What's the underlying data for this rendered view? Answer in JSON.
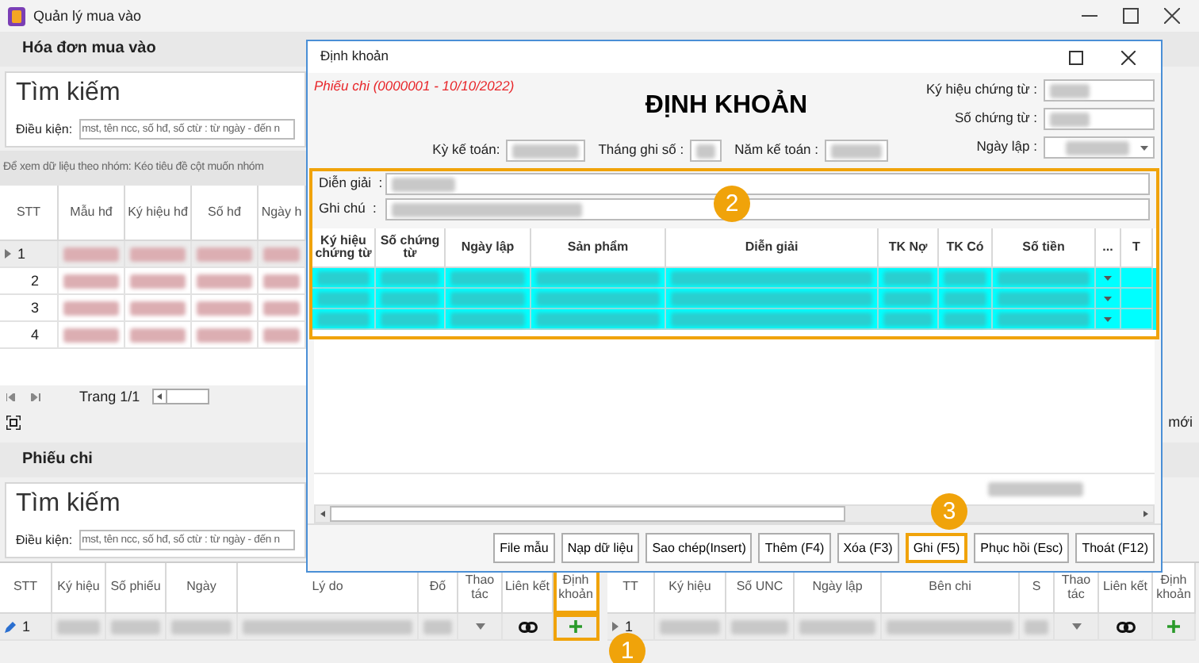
{
  "app": {
    "title": "Quản lý mua vào"
  },
  "invoices": {
    "heading": "Hóa đơn mua vào",
    "search_title": "Tìm kiếm",
    "condition_label": "Điều kiện:",
    "condition_placeholder": "mst, tên ncc, số hđ, số ctừ : từ ngày - đến n",
    "group_hint": "Để xem dữ liệu theo nhóm: Kéo tiêu đề cột muốn nhóm",
    "columns": [
      {
        "label": "STT",
        "kind": "stt"
      },
      {
        "label": "Mẫu hđ",
        "kind": "redacted"
      },
      {
        "label": "Ký hiệu hđ",
        "kind": "redacted"
      },
      {
        "label": "Số hđ",
        "kind": "redacted"
      },
      {
        "label": "Ngày h",
        "kind": "redacted"
      }
    ],
    "rows": [
      {
        "stt": "1",
        "selected": true
      },
      {
        "stt": "2",
        "selected": false
      },
      {
        "stt": "3",
        "selected": false
      },
      {
        "stt": "4",
        "selected": false
      }
    ],
    "pager": "Trang 1/1",
    "new_label": "mới"
  },
  "payments": {
    "heading": "Phiếu chi",
    "search_title": "Tìm kiếm",
    "condition_label": "Điều kiện:",
    "condition_placeholder": "mst, tên ncc, số hđ, số ctừ : từ ngày - đến n",
    "columns": [
      {
        "label": "STT",
        "kind": "stt",
        "highlighted": false
      },
      {
        "label": "Ký hiệu",
        "kind": "redacted",
        "highlighted": false
      },
      {
        "label": "Số phiếu",
        "kind": "redacted",
        "highlighted": false
      },
      {
        "label": "Ngày",
        "kind": "redacted",
        "highlighted": false
      },
      {
        "label": "Lý do",
        "kind": "redacted",
        "highlighted": false
      },
      {
        "label": "Đố",
        "kind": "redacted",
        "highlighted": false
      },
      {
        "label": "Thao tác",
        "kind": "caret",
        "highlighted": false
      },
      {
        "label": "Liên kết",
        "kind": "link",
        "highlighted": false
      },
      {
        "label": "Định khoản",
        "kind": "plus",
        "highlighted": true
      }
    ],
    "rows": [
      {
        "stt": "1",
        "selected": true,
        "editing": true
      }
    ]
  },
  "transfers": {
    "columns": [
      {
        "label": "TT",
        "kind": "stt"
      },
      {
        "label": "Ký hiệu",
        "kind": "redacted"
      },
      {
        "label": "Số UNC",
        "kind": "redacted"
      },
      {
        "label": "Ngày lập",
        "kind": "redacted"
      },
      {
        "label": "Bên chi",
        "kind": "redacted"
      },
      {
        "label": "S",
        "kind": "redacted"
      },
      {
        "label": "Thao tác",
        "kind": "caret"
      },
      {
        "label": "Liên kết",
        "kind": "link"
      },
      {
        "label": "Định khoản",
        "kind": "plus"
      }
    ],
    "rows": [
      {
        "stt": "1",
        "selected": true,
        "editing": false
      }
    ]
  },
  "dialog": {
    "title": "Định khoản",
    "source": "Phiếu chi (0000001 - 10/10/2022)",
    "heading": "ĐỊNH KHOẢN",
    "doc_fields": [
      {
        "label": "Ký hiệu chứng từ :",
        "kind": "text"
      },
      {
        "label": "Số chứng từ :",
        "kind": "text"
      },
      {
        "label": "Ngày lập :",
        "kind": "dropdown"
      }
    ],
    "period_fields": [
      "Kỳ kế toán:",
      "Tháng ghi số :",
      "Năm kế toán :"
    ],
    "form_highlighted": true,
    "notes": [
      "Diễn giải  :",
      "Ghi chú  :"
    ],
    "columns": [
      {
        "label": "Ký hiệu chứng từ",
        "kind": "redacted"
      },
      {
        "label": "Số chứng từ",
        "kind": "redacted"
      },
      {
        "label": "Ngày lập",
        "kind": "redacted"
      },
      {
        "label": "Sản phẩm",
        "kind": "redacted"
      },
      {
        "label": "Diễn giải",
        "kind": "redacted"
      },
      {
        "label": "TK Nợ",
        "kind": "redacted"
      },
      {
        "label": "TK Có",
        "kind": "redacted"
      },
      {
        "label": "Số tiền",
        "kind": "redacted"
      },
      {
        "label": "...",
        "kind": "caret"
      },
      {
        "label": "T",
        "kind": "empty"
      }
    ],
    "rows": [
      {
        "selected": true
      },
      {
        "selected": true
      },
      {
        "selected": true
      }
    ],
    "buttons": [
      {
        "label": "File mẫu",
        "highlighted": false
      },
      {
        "label": "Nạp dữ liệu",
        "highlighted": false
      },
      {
        "label": "Sao chép(Insert)",
        "highlighted": false
      },
      {
        "label": "Thêm (F4)",
        "highlighted": false
      },
      {
        "label": "Xóa (F3)",
        "highlighted": false
      },
      {
        "label": "Ghi (F5)",
        "highlighted": true
      },
      {
        "label": "Phục hồi (Esc)",
        "highlighted": false
      },
      {
        "label": "Thoát (F12)",
        "highlighted": false
      }
    ]
  },
  "callouts": [
    {
      "number": "1"
    },
    {
      "number": "2"
    },
    {
      "number": "3"
    }
  ]
}
